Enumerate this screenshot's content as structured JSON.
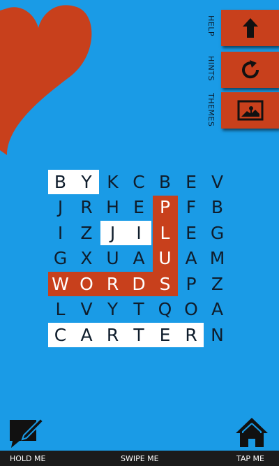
{
  "colors": {
    "background": "#1a9be6",
    "accent": "#c8401c",
    "highlight": "#ffffff",
    "letter": "#0f1d2c",
    "bar": "#1b1b1b"
  },
  "side_menu": {
    "labels": {
      "help": "HELP",
      "hints": "HINTS",
      "themes": "THEMES"
    },
    "buttons": [
      {
        "name": "up-button",
        "icon": "arrow-up-icon"
      },
      {
        "name": "refresh-button",
        "icon": "refresh-icon"
      },
      {
        "name": "theme-button",
        "icon": "landscape-image-icon"
      }
    ]
  },
  "grid": {
    "rows": [
      [
        "B",
        "Y",
        "K",
        "C",
        "B",
        "E",
        "V"
      ],
      [
        "J",
        "R",
        "H",
        "E",
        "P",
        "F",
        "B"
      ],
      [
        "I",
        "Z",
        "J",
        "I",
        "L",
        "E",
        "G"
      ],
      [
        "G",
        "X",
        "U",
        "A",
        "U",
        "A",
        "M"
      ],
      [
        "W",
        "O",
        "R",
        "D",
        "S",
        "P",
        "Z"
      ],
      [
        "L",
        "V",
        "Y",
        "T",
        "Q",
        "O",
        "A"
      ],
      [
        "C",
        "A",
        "R",
        "T",
        "E",
        "R",
        "N"
      ]
    ],
    "found_words": [
      {
        "word": "BY",
        "highlight": "white",
        "cells": [
          [
            0,
            0
          ],
          [
            0,
            1
          ]
        ]
      },
      {
        "word": "JI",
        "highlight": "white",
        "cells": [
          [
            2,
            2
          ],
          [
            2,
            3
          ]
        ]
      },
      {
        "word": "CARTER",
        "highlight": "white",
        "cells": [
          [
            6,
            0
          ],
          [
            6,
            1
          ],
          [
            6,
            2
          ],
          [
            6,
            3
          ],
          [
            6,
            4
          ],
          [
            6,
            5
          ]
        ]
      },
      {
        "word": "WORDS",
        "highlight": "orange",
        "cells": [
          [
            4,
            0
          ],
          [
            4,
            1
          ],
          [
            4,
            2
          ],
          [
            4,
            3
          ],
          [
            4,
            4
          ]
        ]
      },
      {
        "word": "PLUS",
        "highlight": "orange",
        "cells": [
          [
            1,
            4
          ],
          [
            2,
            4
          ],
          [
            3,
            4
          ],
          [
            4,
            4
          ]
        ]
      }
    ]
  },
  "bottom_bar": {
    "left": "HOLD ME",
    "center": "SWIPE ME",
    "right": "TAP ME"
  },
  "bottom_icons": {
    "left": "edit-chat-icon",
    "right": "home-icon"
  }
}
